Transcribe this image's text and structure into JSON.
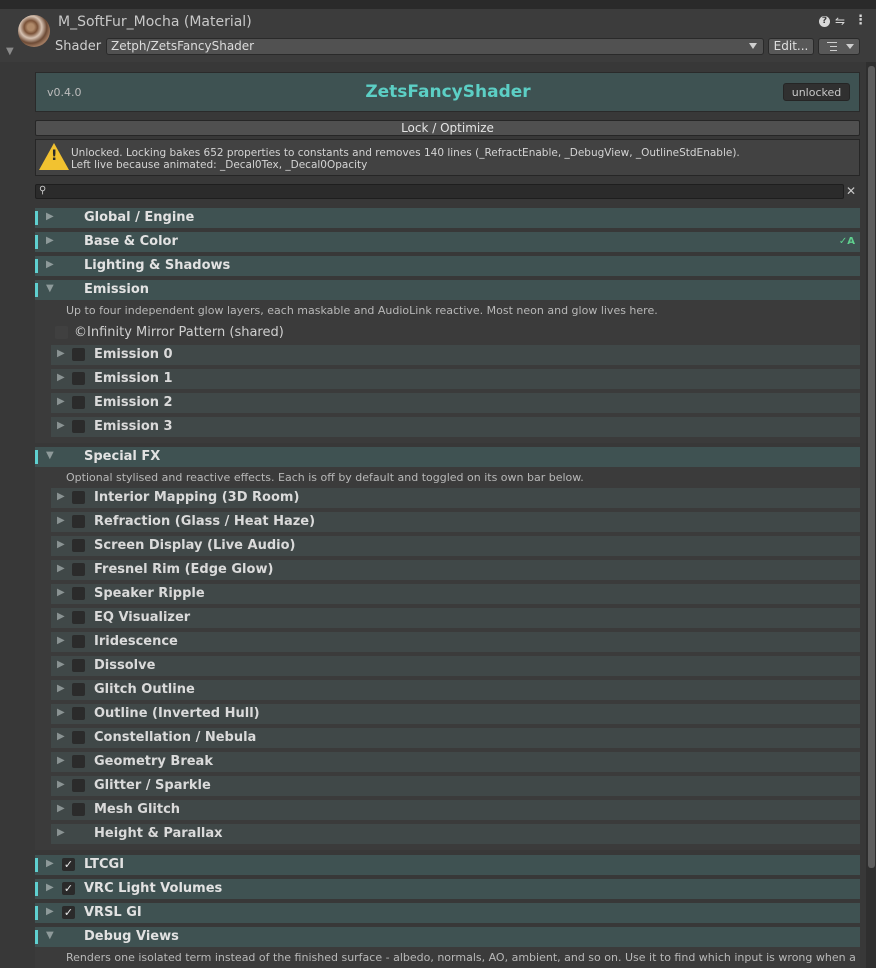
{
  "header": {
    "material_name": "M_SoftFur_Mocha (Material)",
    "shader_label": "Shader",
    "shader_value": "Zetph/ZetsFancyShader",
    "edit_label": "Edit...",
    "help_glyph": "?"
  },
  "inspector": {
    "version": "v0.4.0",
    "shader_title": "ZetsFancyShader",
    "status": "unlocked",
    "lock_label": "Lock / Optimize",
    "warning_line1": "Unlocked. Locking bakes 652 properties to constants and removes 140 lines (_RefractEnable, _DebugView, _OutlineStdEnable).",
    "warning_line2": "Left live because animated: _Decal0Tex, _Decal0Opacity",
    "search_placeholder": "",
    "search_clear": "✕"
  },
  "sections": {
    "global": "Global / Engine",
    "base": "Base & Color",
    "base_indicator": "✓A",
    "lighting": "Lighting & Shadows",
    "emission": "Emission",
    "emission_desc": "Up to four independent glow layers, each maskable and AudioLink reactive. Most neon and glow lives here.",
    "emission_shared": "Infinity Mirror Pattern (shared)",
    "emission_items": [
      "Emission 0",
      "Emission 1",
      "Emission 2",
      "Emission 3"
    ],
    "fx": "Special FX",
    "fx_desc": "Optional stylised and reactive effects. Each is off by default and toggled on its own bar below.",
    "fx_items": [
      "Interior Mapping (3D Room)",
      "Refraction (Glass / Heat Haze)",
      "Screen Display (Live Audio)",
      "Fresnel Rim (Edge Glow)",
      "Speaker Ripple",
      "EQ Visualizer",
      "Iridescence",
      "Dissolve",
      "Glitch Outline",
      "Outline (Inverted Hull)",
      "Constellation / Nebula",
      "Geometry Break",
      "Glitter / Sparkle",
      "Mesh Glitch"
    ],
    "fx_height": "Height & Parallax",
    "ltcgi": "LTCGI",
    "vrc": "VRC Light Volumes",
    "vrsl": "VRSL GI",
    "debug": "Debug Views",
    "debug_desc": "Renders one isolated term instead of the finished surface - albedo, normals, AO, ambient, and so on. Use it to find which input is wrong when a"
  },
  "colors": {
    "accent": "#5fd0d0",
    "section_bg": "#3f5252",
    "title": "#5ccfc5",
    "warning": "#f2c230"
  }
}
